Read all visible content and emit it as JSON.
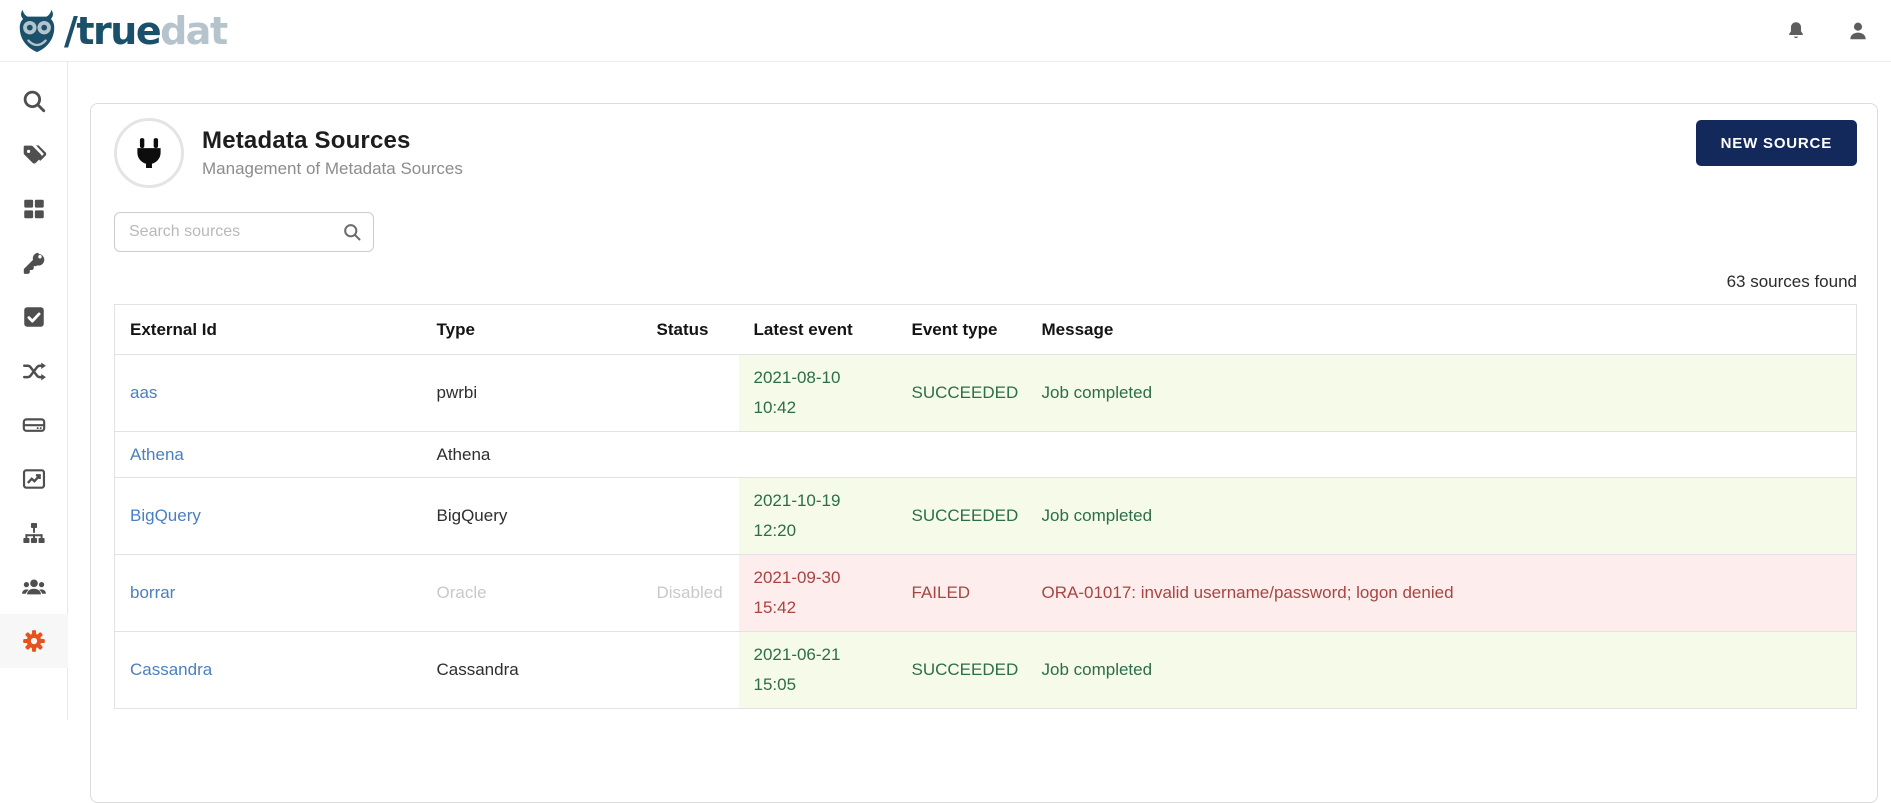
{
  "colors": {
    "brand-navy": "#13295c",
    "brand-dark": "#1b506a",
    "brand-light": "#b4c3cc",
    "accent-orange": "#e8521c",
    "link": "#4a7fc0",
    "success-text": "#2c6e49",
    "success-bg": "#f5fae9",
    "failure-text": "#a94442",
    "failure-bg": "#fdeeed",
    "disabled-text": "#c9c9c9"
  },
  "header": {
    "logo_dark": "/true",
    "logo_light": "dat",
    "icons": [
      "owl-logo-icon",
      "notifications-bell-icon",
      "user-avatar-icon"
    ]
  },
  "sidebar": {
    "items": [
      {
        "icon": "search-icon",
        "active": false
      },
      {
        "icon": "tags-icon",
        "active": false
      },
      {
        "icon": "grid-icon",
        "active": false
      },
      {
        "icon": "key-icon",
        "active": false
      },
      {
        "icon": "check-square-icon",
        "active": false
      },
      {
        "icon": "shuffle-icon",
        "active": false
      },
      {
        "icon": "hard-drive-icon",
        "active": false
      },
      {
        "icon": "chart-line-icon",
        "active": false
      },
      {
        "icon": "sitemap-icon",
        "active": false
      },
      {
        "icon": "users-icon",
        "active": false
      },
      {
        "icon": "settings-gear-icon",
        "active": true
      }
    ]
  },
  "page": {
    "avatar_icon": "plug-icon",
    "title": "Metadata Sources",
    "subtitle": "Management of Metadata Sources",
    "new_source_label": "NEW SOURCE",
    "search_placeholder": "Search sources",
    "results_count": "63 sources found"
  },
  "table": {
    "columns": [
      "External Id",
      "Type",
      "Status",
      "Latest event",
      "Event type",
      "Message"
    ],
    "rows": [
      {
        "external_id": "aas",
        "type": "pwrbi",
        "status": "",
        "latest_event": "2021-08-10 10:42",
        "event_type": "SUCCEEDED",
        "message": "Job completed",
        "state": "success",
        "disabled": false
      },
      {
        "external_id": "Athena",
        "type": "Athena",
        "status": "",
        "latest_event": "",
        "event_type": "",
        "message": "",
        "state": "none",
        "disabled": false
      },
      {
        "external_id": "BigQuery",
        "type": "BigQuery",
        "status": "",
        "latest_event": "2021-10-19 12:20",
        "event_type": "SUCCEEDED",
        "message": "Job completed",
        "state": "success",
        "disabled": false
      },
      {
        "external_id": "borrar",
        "type": "Oracle",
        "status": "Disabled",
        "latest_event": "2021-09-30 15:42",
        "event_type": "FAILED",
        "message": "ORA-01017: invalid username/password; logon denied",
        "state": "failure",
        "disabled": true
      },
      {
        "external_id": "Cassandra",
        "type": "Cassandra",
        "status": "",
        "latest_event": "2021-06-21 15:05",
        "event_type": "SUCCEEDED",
        "message": "Job completed",
        "state": "success",
        "disabled": false
      }
    ]
  }
}
